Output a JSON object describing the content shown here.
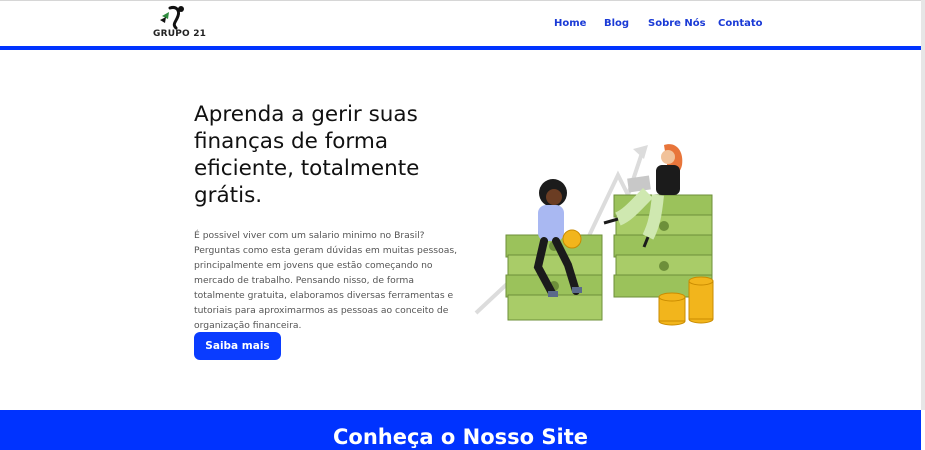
{
  "header": {
    "logo_text": "GRUPO 21",
    "nav": [
      {
        "label": "Home"
      },
      {
        "label": "Blog"
      },
      {
        "label": "Sobre Nós"
      },
      {
        "label": "Contato"
      }
    ]
  },
  "hero": {
    "headline": "Aprenda a gerir suas finanças de forma eficiente, totalmente grátis.",
    "body": "É possivel viver com um salario minimo no Brasil? Perguntas como esta geram dúvidas em muitas pessoas, principalmente em jovens que estão começando no mercado de trabalho. Pensando nisso, de forma totalmente gratuita, elaboramos diversas ferramentas e tutoriais para aproximarmos as pessoas ao conceito de organização financeira.",
    "cta_label": "Saiba mais",
    "illustration_icon": "finance-illustration"
  },
  "section": {
    "title": "Conheça o Nosso Site"
  },
  "colors": {
    "accent": "#0033ff",
    "nav_text": "#1a3ad6",
    "money_green": "#9bc25b",
    "coin_gold": "#f2b51c"
  }
}
